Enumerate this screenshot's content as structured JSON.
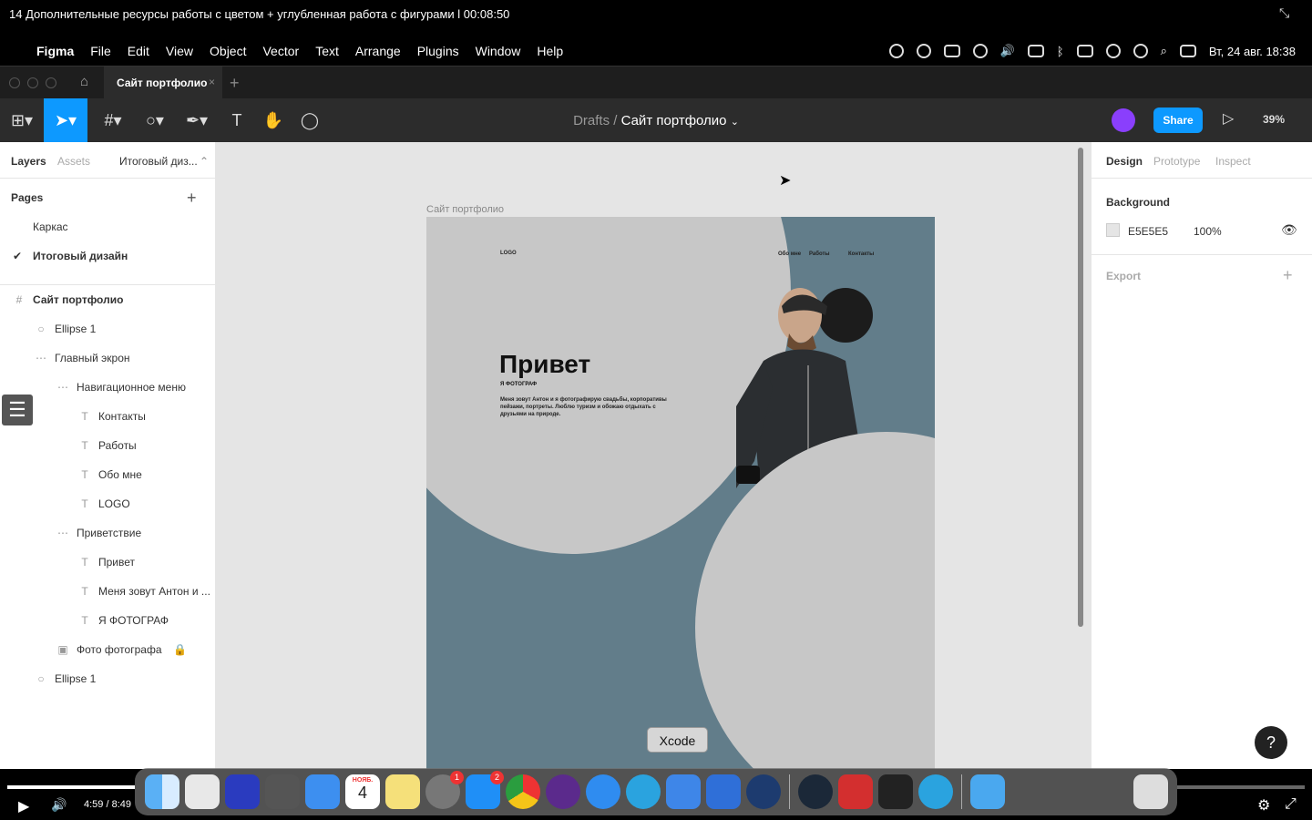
{
  "video": {
    "title": "14 Дополнительные ресурсы работы с цветом + углубленная работа с фигурами l 00:08:50",
    "time": "4:59 / 8:49"
  },
  "menubar": {
    "app": "Figma",
    "items": [
      "File",
      "Edit",
      "View",
      "Object",
      "Vector",
      "Text",
      "Arrange",
      "Plugins",
      "Window",
      "Help"
    ],
    "clock": "Вт, 24 авг.  18:38"
  },
  "tabs": {
    "file_tab": "Сайт портфолио"
  },
  "toolbar": {
    "breadcrumb_root": "Drafts",
    "breadcrumb_sep": "/",
    "breadcrumb_file": "Сайт портфолио",
    "share_label": "Share",
    "zoom": "39%"
  },
  "left_panel": {
    "tab_layers": "Layers",
    "tab_assets": "Assets",
    "page_selector": "Итоговый диз...",
    "pages_title": "Pages",
    "pages": [
      "Каркас",
      "Итоговый дизайн"
    ],
    "layers": [
      {
        "name": "Сайт портфолио",
        "icon": "frame-icon",
        "depth": 0
      },
      {
        "name": "Ellipse 1",
        "icon": "ellipse-icon",
        "depth": 1
      },
      {
        "name": "Главный экрон",
        "icon": "group-icon",
        "depth": 1
      },
      {
        "name": "Навигационное меню",
        "icon": "group-icon",
        "depth": 2
      },
      {
        "name": "Контакты",
        "icon": "text-icon",
        "depth": 3
      },
      {
        "name": "Работы",
        "icon": "text-icon",
        "depth": 3
      },
      {
        "name": "Обо мне",
        "icon": "text-icon",
        "depth": 3
      },
      {
        "name": "LOGO",
        "icon": "text-icon",
        "depth": 3
      },
      {
        "name": "Приветствие",
        "icon": "group-icon",
        "depth": 2
      },
      {
        "name": "Привет",
        "icon": "text-icon",
        "depth": 3
      },
      {
        "name": "Меня зовут Антон и ...",
        "icon": "text-icon",
        "depth": 3
      },
      {
        "name": "Я ФОТОГРАФ",
        "icon": "text-icon",
        "depth": 3
      },
      {
        "name": "Фото фотографа",
        "icon": "image-icon",
        "depth": 2
      },
      {
        "name": "Ellipse 1",
        "icon": "ellipse-icon",
        "depth": 1
      }
    ]
  },
  "canvas": {
    "frame_label": "Сайт портфолио",
    "logo": "LOGO",
    "nav": [
      "Обо мне",
      "Работы",
      "Контакты"
    ],
    "hello": "Привет",
    "subtitle": "Я ФОТОГРАФ",
    "description": "Меня зовут Антон и я фотографирую свадьбы, корпоративы пейзажи, портреты. Люблю туризм и обожаю отдыхать с друзьями на природе.",
    "tooltip": "Xcode"
  },
  "right_panel": {
    "tab_design": "Design",
    "tab_prototype": "Prototype",
    "tab_inspect": "Inspect",
    "background_title": "Background",
    "bg_hex": "E5E5E5",
    "bg_opacity": "100%",
    "export_title": "Export"
  },
  "dock": {
    "calendar_month": "НОЯБ.",
    "calendar_day": "4",
    "settings_badge": "1",
    "appstore_badge": "2"
  },
  "colors": {
    "accent": "#0d99ff",
    "frame_bg": "#627d8a",
    "circle": "#c7c7c7",
    "canvas_bg": "#e5e5e5"
  }
}
